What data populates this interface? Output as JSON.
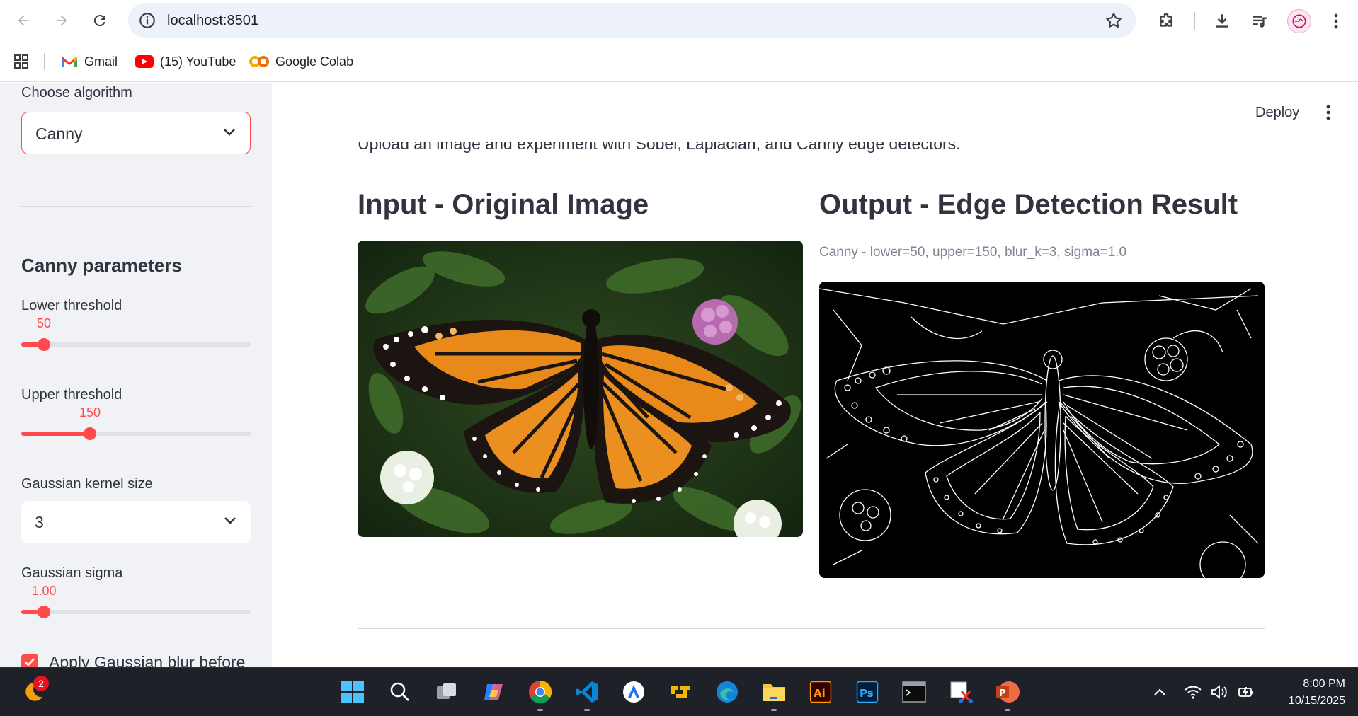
{
  "browser": {
    "url": "localhost:8501",
    "bookmarks": [
      {
        "label": "Gmail",
        "icon": "gmail-icon"
      },
      {
        "label": "(15) YouTube",
        "icon": "youtube-icon"
      },
      {
        "label": "Google Colab",
        "icon": "colab-icon"
      }
    ]
  },
  "sidebar": {
    "algorithm_label": "Choose algorithm",
    "algorithm_value": "Canny",
    "params_heading": "Canny parameters",
    "lower_threshold": {
      "label": "Lower threshold",
      "value_text": "50",
      "fraction": 0.1
    },
    "upper_threshold": {
      "label": "Upper threshold",
      "value_text": "150",
      "fraction": 0.3
    },
    "kernel": {
      "label": "Gaussian kernel size",
      "value": "3"
    },
    "sigma": {
      "label": "Gaussian sigma",
      "value_text": "1.00",
      "fraction": 0.1
    },
    "blur_checkbox": {
      "label": "Apply Gaussian blur before",
      "checked": true
    }
  },
  "main": {
    "deploy_label": "Deploy",
    "intro_text": "Upload an image and experiment with Sobel, Laplacian, and Canny edge detectors.",
    "input_title": "Input - Original Image",
    "output_title": "Output - Edge Detection Result",
    "output_caption": "Canny - lower=50, upper=150, blur_k=3, sigma=1.0"
  },
  "taskbar": {
    "notification_count": "2",
    "time": "8:00 PM",
    "date": "10/15/2025"
  },
  "colors": {
    "accent": "#ff4b4b",
    "sidebar_bg": "#f0f2f6",
    "taskbar_bg": "#1f2128"
  }
}
